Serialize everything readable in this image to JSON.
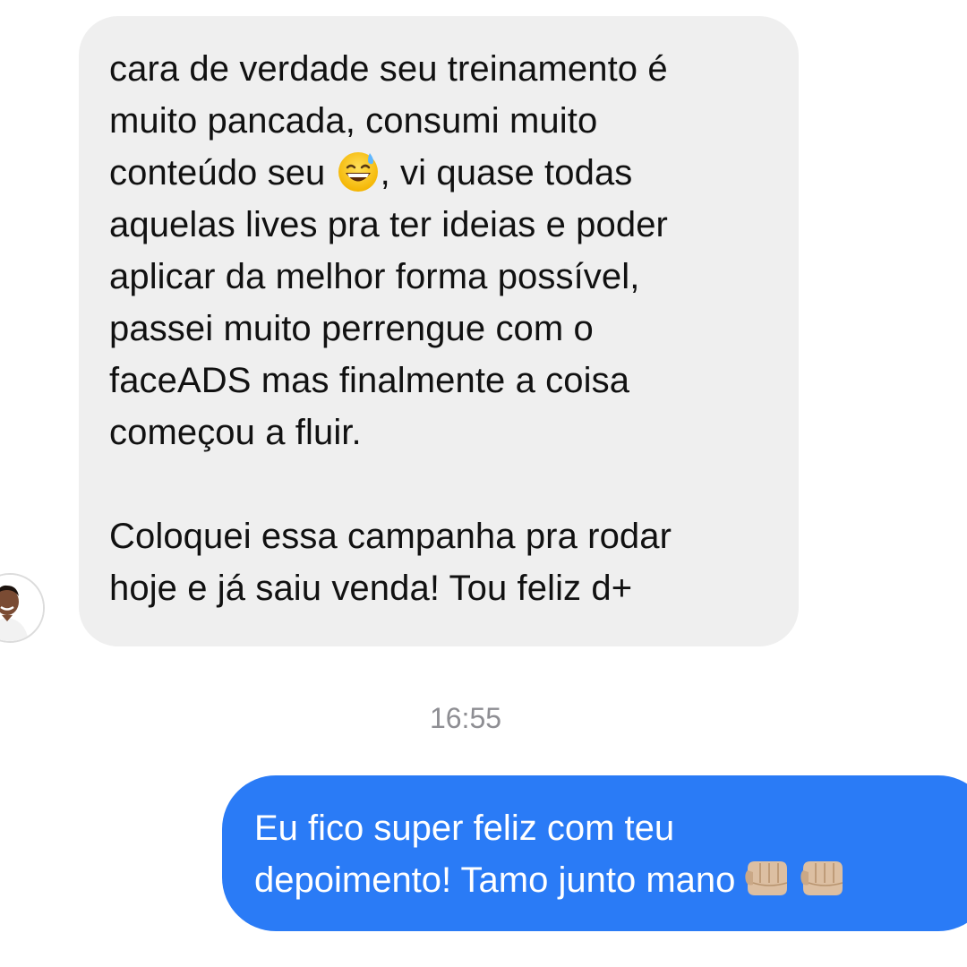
{
  "conversation": {
    "incoming": {
      "lines": [
        "cara de verdade seu treinamento é",
        "muito pancada, consumi muito",
        "conteúdo seu",
        ", vi quase todas",
        "aquelas lives pra ter ideias e poder",
        "aplicar da melhor forma possível,",
        "passei muito perrengue com o",
        "faceADS mas finalmente a coisa",
        "começou a fluir."
      ],
      "paragraph2": [
        "Coloquei essa campanha pra rodar",
        "hoje e já saiu venda! Tou feliz d+"
      ],
      "emoji": "grinning-face-with-sweat-icon"
    },
    "timestamp": "16:55",
    "outgoing": {
      "lines": [
        "Eu fico super feliz com teu",
        "depoimento! Tamo junto mano"
      ],
      "emoji": "oncoming-fist-icon"
    },
    "colors": {
      "incoming_bubble": "#efefef",
      "outgoing_bubble": "#2a7bf6",
      "timestamp": "#8e8e93"
    }
  }
}
